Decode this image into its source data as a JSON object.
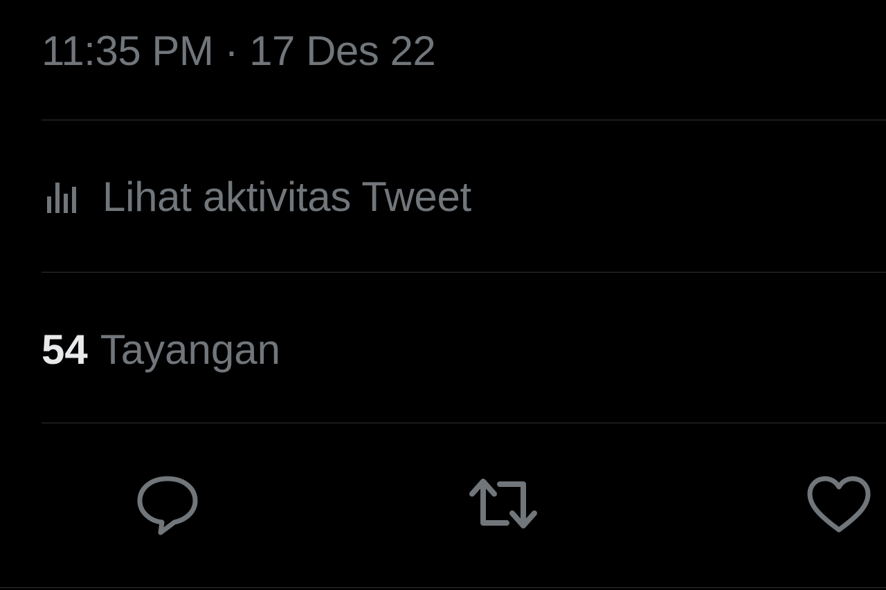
{
  "tweet": {
    "timestamp": "11:35 PM · 17 Des 22",
    "analytics_label": "Lihat aktivitas Tweet",
    "views": {
      "count": "54",
      "label": "Tayangan"
    }
  },
  "actions": {
    "reply_icon": "reply-icon",
    "retweet_icon": "retweet-icon",
    "like_icon": "heart-icon"
  },
  "colors": {
    "background": "#000000",
    "muted_text": "#71767b",
    "primary_text": "#e7e9ea",
    "divider": "#2f3336"
  }
}
